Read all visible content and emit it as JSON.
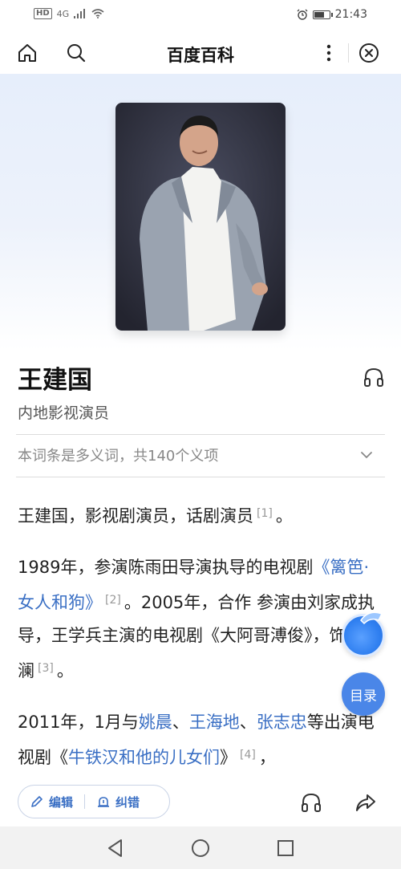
{
  "status_bar": {
    "left": {
      "hd": "HD",
      "network": "4G"
    },
    "right": {
      "time": "21:43"
    }
  },
  "nav": {
    "title": "百度百科",
    "icons": [
      "home-icon",
      "search-icon",
      "more-icon",
      "close-icon"
    ]
  },
  "entry": {
    "title": "王建国",
    "subtitle": "内地影视演员",
    "polysemy": "本词条是多义词，共140个义项"
  },
  "article": {
    "p1": {
      "text": "王建国，影视剧演员，话剧演员",
      "ref": "[1]",
      "end": "。"
    },
    "p2": {
      "t1": "1989年，参演陈雨田导演执导的电视剧",
      "link1": "《篱笆·女人和狗》",
      "ref1": "[2]",
      "t2": "。2005年，合作 参演由刘家成执导，王学兵主演的电视剧《大阿哥溥俊》，饰演载澜",
      "ref2": "[3]",
      "t3": "。"
    },
    "p3": {
      "t1": "2011年，1月与",
      "link1": "姚晨",
      "sep1": "、",
      "link2": "王海地",
      "sep2": "、",
      "link3": "张志忠",
      "t2": "等出演电视剧《",
      "link4": "牛铁汉和他的儿女们",
      "t3": "》",
      "ref": "[4]",
      "t4": "，"
    }
  },
  "float": {
    "toc_label": "目录"
  },
  "bottom_bar": {
    "edit_label": "编辑",
    "report_label": "纠错"
  }
}
